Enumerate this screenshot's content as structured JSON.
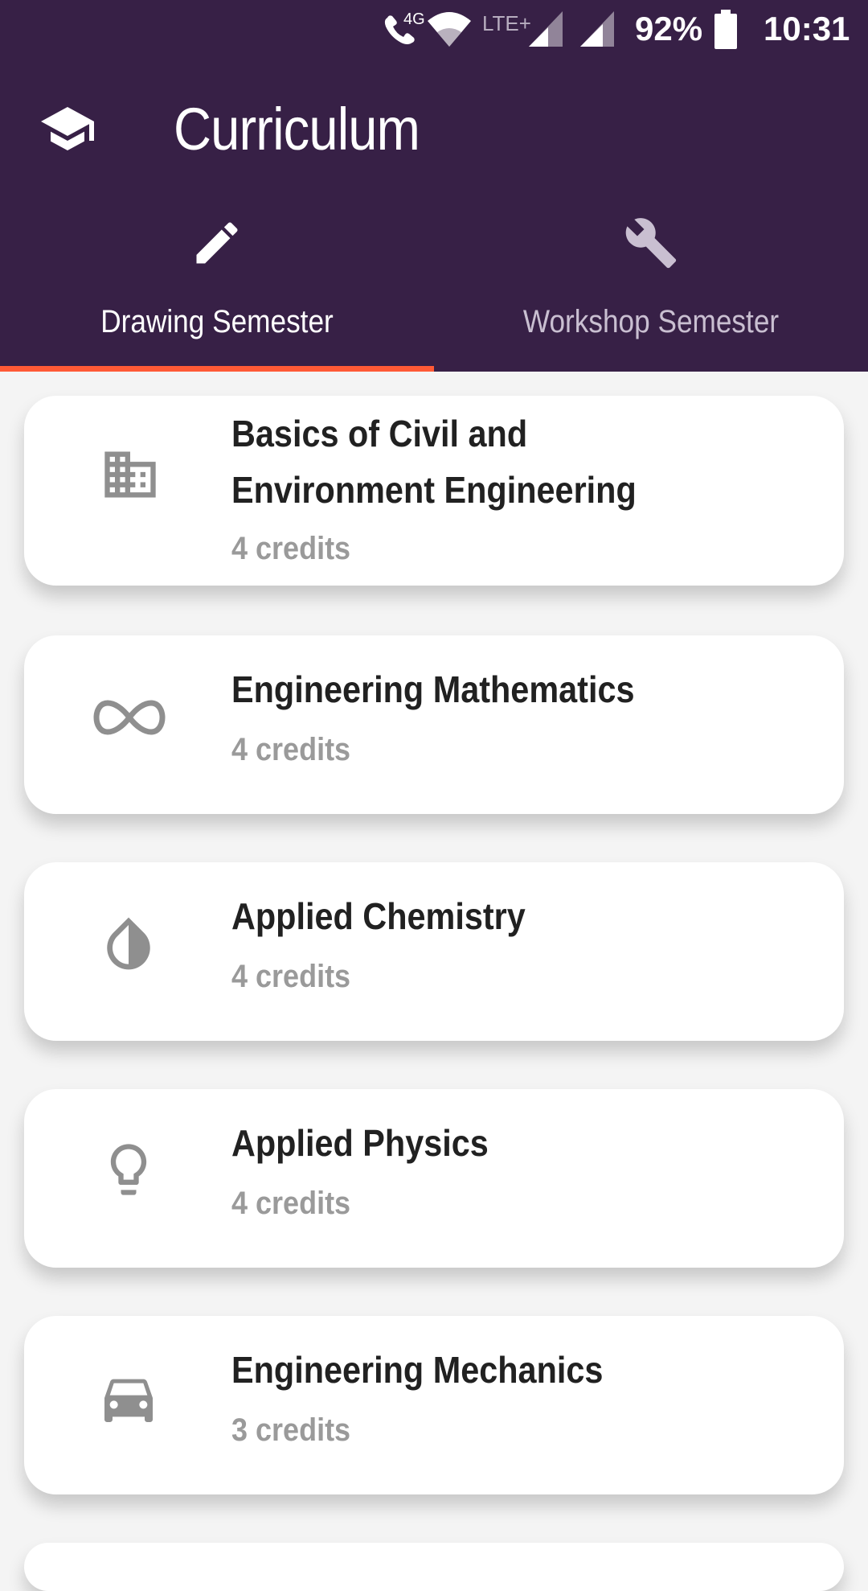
{
  "status_bar": {
    "network_type": "4G",
    "lte_label": "LTE+",
    "battery": "92%",
    "time": "10:31"
  },
  "header": {
    "title": "Curriculum",
    "icon": "school-cap-icon"
  },
  "tabs": [
    {
      "label": "Drawing Semester",
      "icon": "pencil-icon",
      "active": true
    },
    {
      "label": "Workshop Semester",
      "icon": "wrench-icon",
      "active": false
    }
  ],
  "courses": [
    {
      "title_line1": "Basics of Civil and",
      "title_line2": "Environment Engineering",
      "credits": "4 credits",
      "icon": "building-icon"
    },
    {
      "title": "Engineering Mathematics",
      "credits": "4 credits",
      "icon": "infinity-icon"
    },
    {
      "title": "Applied Chemistry",
      "credits": "4 credits",
      "icon": "drop-icon"
    },
    {
      "title": "Applied Physics",
      "credits": "4 credits",
      "icon": "lightbulb-icon"
    },
    {
      "title": "Engineering Mechanics",
      "credits": "3 credits",
      "icon": "car-icon"
    }
  ],
  "colors": {
    "app_bar": "#372046",
    "tab_indicator": "#ff5a36",
    "icon_gray": "#8f8f8f"
  }
}
